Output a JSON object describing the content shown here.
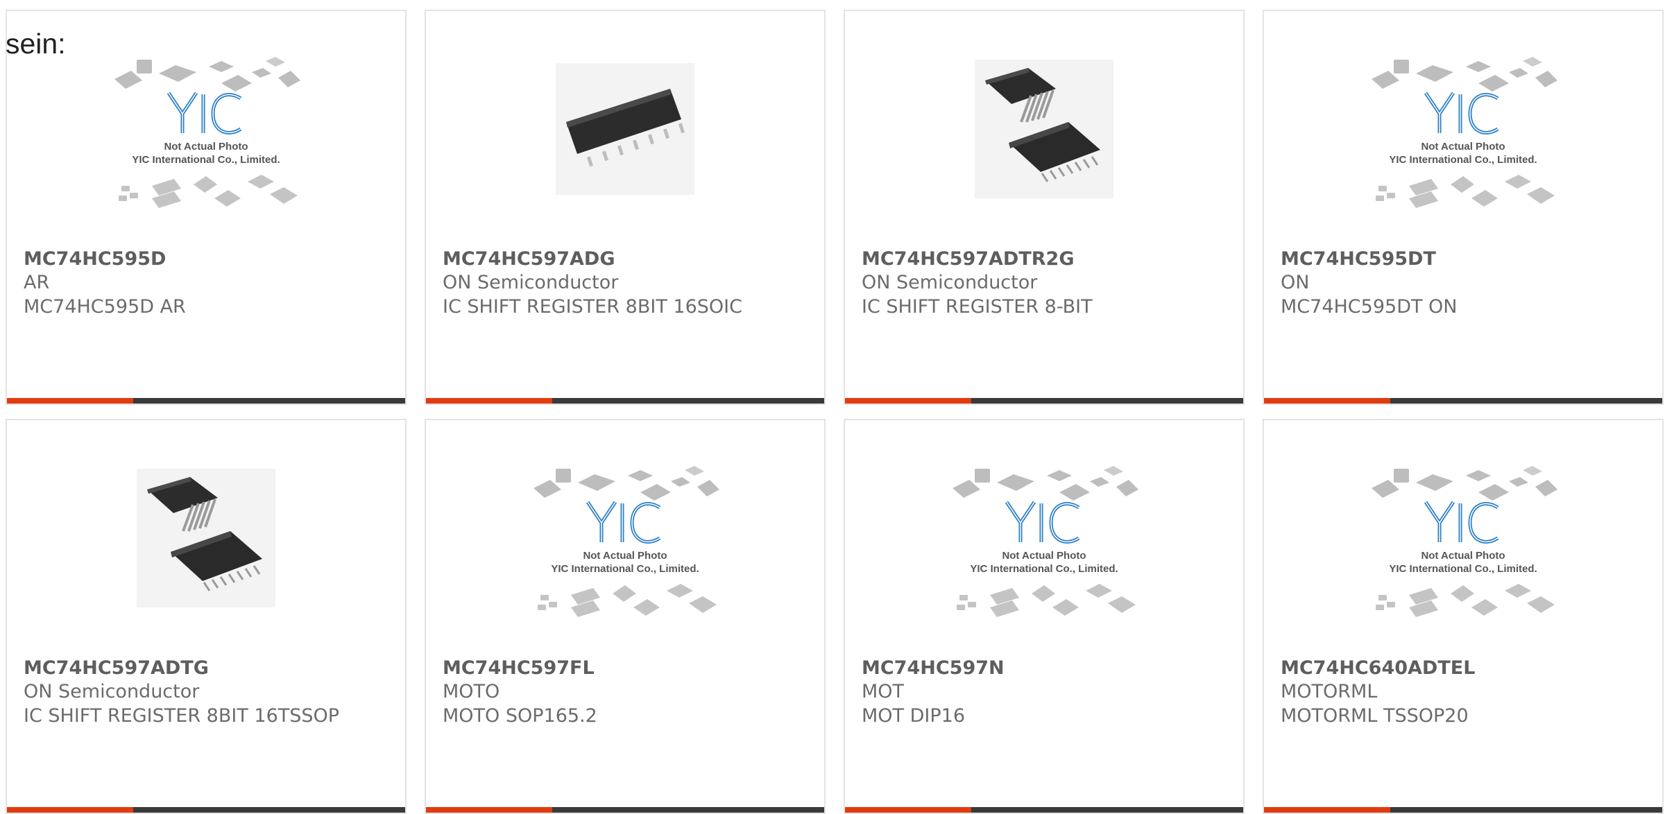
{
  "page": {
    "label": "sein:"
  },
  "colors": {
    "accent": "#e13c0f",
    "bar": "#3a3a3a",
    "border": "#e3e3e3",
    "logo": "#2a7fc7"
  },
  "placeholder": {
    "line1": "Not Actual Photo",
    "line2": "YIC International Co., Limited."
  },
  "products": [
    {
      "part": "MC74HC595D",
      "manufacturer": "AR",
      "description": "MC74HC595D AR",
      "image": "placeholder"
    },
    {
      "part": "MC74HC597ADG",
      "manufacturer": "ON Semiconductor",
      "description": "IC SHIFT REGISTER 8BIT 16SOIC",
      "image": "soic-chip"
    },
    {
      "part": "MC74HC597ADTR2G",
      "manufacturer": "ON Semiconductor",
      "description": "IC SHIFT REGISTER 8-BIT",
      "image": "tssop-chip"
    },
    {
      "part": "MC74HC595DT",
      "manufacturer": "ON",
      "description": "MC74HC595DT ON",
      "image": "placeholder"
    },
    {
      "part": "MC74HC597ADTG",
      "manufacturer": "ON Semiconductor",
      "description": "IC SHIFT REGISTER 8BIT 16TSSOP",
      "image": "tssop-chip"
    },
    {
      "part": "MC74HC597FL",
      "manufacturer": "MOTO",
      "description": "MOTO SOP165.2",
      "image": "placeholder"
    },
    {
      "part": "MC74HC597N",
      "manufacturer": "MOT",
      "description": "MOT DIP16",
      "image": "placeholder"
    },
    {
      "part": "MC74HC640ADTEL",
      "manufacturer": "MOTORML",
      "description": "MOTORML TSSOP20",
      "image": "placeholder"
    }
  ]
}
